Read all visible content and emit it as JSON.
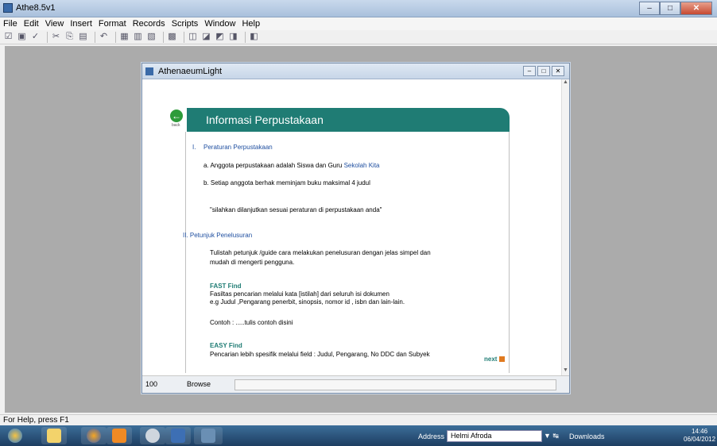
{
  "app": {
    "title": "Athe8.5v1"
  },
  "menu": [
    "File",
    "Edit",
    "View",
    "Insert",
    "Format",
    "Records",
    "Scripts",
    "Window",
    "Help"
  ],
  "window": {
    "title": "AthenaeumLight"
  },
  "page": {
    "back_label": "back",
    "banner_title": "Informasi Perpustakaan",
    "section1_number": "I.",
    "section1_title": "Peraturan Perpustakaan",
    "rule_a_prefix": "a. Anggota perpustakaan adalah  Siswa dan Guru ",
    "rule_a_highlight": "Sekolah Kita",
    "rule_b": "b. Setiap anggota berhak meminjam buku maksimal 4 judul",
    "note": "\"silahkan dilanjutkan sesuai peraturan di perpustakaan anda\"",
    "section2_title": "II. Petunjuk Penelusuran",
    "guide_line1": "Tulistah petunjuk /guide cara melakukan penelusuran  dengan jelas simpel  dan",
    "guide_line2": "mudah di mengerti pengguna.",
    "fast_title": "FAST Find",
    "fast_line1": "Fasiltas pencarian melalui kata [istilah] dari seluruh isi dokumen",
    "fast_line2": "e.g  Judul ,Pengarang penerbit, sinopsis, nomor id , isbn dan lain-lain.",
    "example": "Contoh :   .....tulis contoh disini",
    "easy_title": "EASY Find",
    "easy_line1": "Pencarian lebih spesifik melalui field  : Judul, Pengarang, No DDC dan Subyek",
    "next_label": "next"
  },
  "window_status": {
    "zoom": "100",
    "mode": "Browse"
  },
  "help_text": "For Help, press F1",
  "taskbar": {
    "address_label": "Address",
    "address_value": "Helmi Afroda",
    "downloads_label": "Downloads",
    "time": "14:46",
    "date": "06/04/2012"
  },
  "colors": {
    "banner": "#1f7c74",
    "link": "#1f4fa0",
    "next_square": "#e07a1f"
  }
}
